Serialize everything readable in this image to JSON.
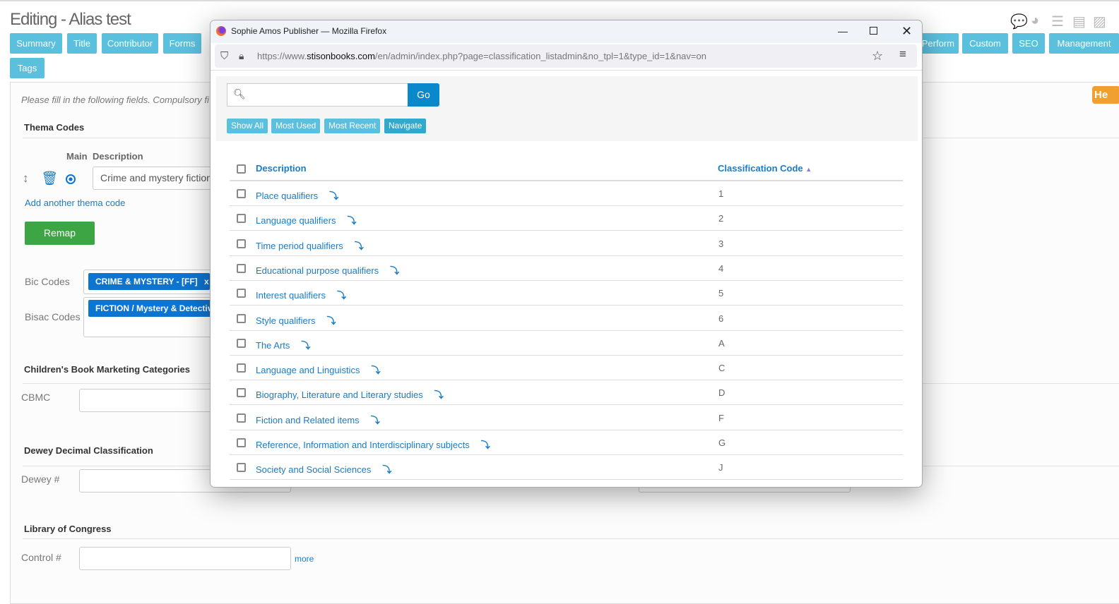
{
  "page": {
    "title": "Editing - Alias test",
    "note": "Please fill in the following fields. Compulsory fi",
    "help": "He"
  },
  "tabs": [
    "Summary",
    "Title",
    "Contributor",
    "Forms",
    "Perform",
    "Custom",
    "SEO",
    "Management",
    "Tags"
  ],
  "top_icons": [
    "comments-icon",
    "dashboard-icon",
    "list-icon",
    "archive-icon",
    "image-icon"
  ],
  "thema": {
    "heading": "Thema Codes",
    "col_main": "Main",
    "col_desc": "Description",
    "value": "Crime and mystery fiction",
    "add_link": "Add another thema code",
    "remap": "Remap"
  },
  "bic": {
    "label": "Bic Codes",
    "chip": "CRIME & MYSTERY - [FF]",
    "chip_x": "x"
  },
  "bisac": {
    "label": "Bisac Codes",
    "chip": "FICTION / Mystery & Detective"
  },
  "cbmc": {
    "heading": "Children's Book Marketing Categories",
    "label": "CBMC"
  },
  "dewey": {
    "heading": "Dewey Decimal Classification",
    "label": "Dewey #"
  },
  "loc": {
    "heading": "Library of Congress",
    "label": "Control #",
    "more": "more"
  },
  "popup": {
    "window_title": "Sophie Amos Publisher — Mozilla Firefox",
    "url_prefix": "https://www.",
    "url_domain": "stisonbooks.com",
    "url_rest": "/en/admin/index.php?page=classification_listadmin&no_tpl=1&type_id=1&nav=on",
    "search_placeholder": "",
    "go": "Go",
    "filters": [
      "Show All",
      "Most Used",
      "Most Recent",
      "Navigate"
    ],
    "col_desc": "Description",
    "col_code": "Classification Code",
    "rows": [
      {
        "desc": "Place qualifiers",
        "code": "1"
      },
      {
        "desc": "Language qualifiers",
        "code": "2"
      },
      {
        "desc": "Time period qualifiers",
        "code": "3"
      },
      {
        "desc": "Educational purpose qualifiers",
        "code": "4"
      },
      {
        "desc": "Interest qualifiers",
        "code": "5"
      },
      {
        "desc": "Style qualifiers",
        "code": "6"
      },
      {
        "desc": "The Arts",
        "code": "A"
      },
      {
        "desc": "Language and Linguistics",
        "code": "C"
      },
      {
        "desc": "Biography, Literature and Literary studies",
        "code": "D"
      },
      {
        "desc": "Fiction and Related items",
        "code": "F"
      },
      {
        "desc": "Reference, Information and Interdisciplinary subjects",
        "code": "G"
      },
      {
        "desc": "Society and Social Sciences",
        "code": "J"
      }
    ]
  }
}
